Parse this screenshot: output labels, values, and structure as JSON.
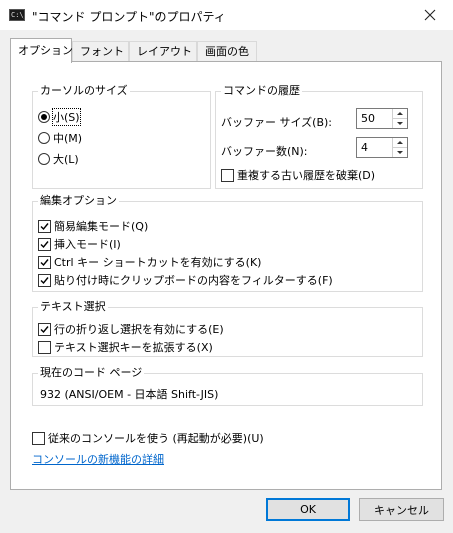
{
  "window": {
    "title": "\"コマンド プロンプト\"のプロパティ",
    "app_icon": "cmd-window-icon",
    "icon_glyph": "C:\\_"
  },
  "tabs": [
    {
      "label": "オプション",
      "active": true
    },
    {
      "label": "フォント",
      "active": false
    },
    {
      "label": "レイアウト",
      "active": false
    },
    {
      "label": "画面の色",
      "active": false
    }
  ],
  "cursor_size": {
    "title": "カーソルのサイズ",
    "small": "小(S)",
    "medium": "中(M)",
    "large": "大(L)",
    "selected": "small"
  },
  "history": {
    "title": "コマンドの履歴",
    "buffer_size_label": "バッファー サイズ(B):",
    "buffer_size_value": "50",
    "buffer_count_label": "バッファー数(N):",
    "buffer_count_value": "4",
    "discard_duplicates_label": "重複する古い履歴を破棄(D)",
    "discard_duplicates_checked": false
  },
  "edit_options": {
    "title": "編集オプション",
    "quick_edit": "簡易編集モード(Q)",
    "insert_mode": "挿入モード(I)",
    "ctrl_shortcuts": "Ctrl キー ショートカットを有効にする(K)",
    "filter_clipboard": "貼り付け時にクリップボードの内容をフィルターする(F)",
    "checked": [
      true,
      true,
      true,
      true
    ]
  },
  "text_selection": {
    "title": "テキスト選択",
    "line_wrap": "行の折り返し選択を有効にする(E)",
    "extend_keys": "テキスト選択キーを拡張する(X)",
    "checked": [
      true,
      false
    ]
  },
  "codepage": {
    "title": "現在のコード ページ",
    "value": "932   (ANSI/OEM - 日本語 Shift-JIS)"
  },
  "legacy_console": {
    "label": "従来のコンソールを使う (再起動が必要)(U)",
    "checked": false
  },
  "learn_more_link": "コンソールの新機能の詳細",
  "buttons": {
    "ok": "OK",
    "cancel": "キャンセル"
  }
}
